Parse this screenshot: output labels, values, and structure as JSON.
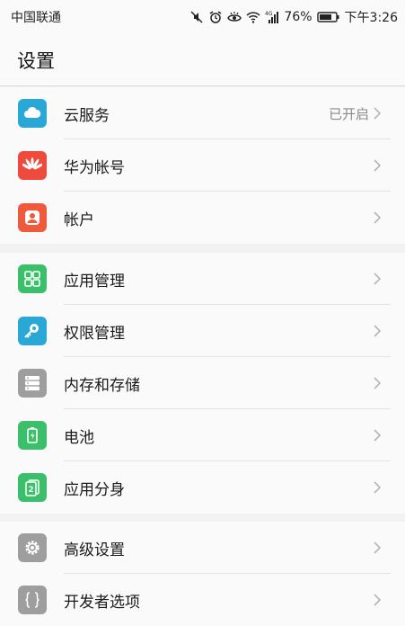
{
  "status_bar": {
    "carrier": "中国联通",
    "network_label": "4G",
    "battery_percent": "76%",
    "time": "下午3:26"
  },
  "header": {
    "title": "设置"
  },
  "groups": [
    {
      "items": [
        {
          "label": "云服务",
          "value": "已开启",
          "icon": "cloud-icon",
          "color": "#29a8d8"
        },
        {
          "label": "华为帐号",
          "value": "",
          "icon": "huawei-logo-icon",
          "color": "#ee4b3c"
        },
        {
          "label": "帐户",
          "value": "",
          "icon": "user-account-icon",
          "color": "#f05a3c"
        }
      ]
    },
    {
      "items": [
        {
          "label": "应用管理",
          "value": "",
          "icon": "app-grid-icon",
          "color": "#3bbf6a"
        },
        {
          "label": "权限管理",
          "value": "",
          "icon": "key-icon",
          "color": "#29a8d8"
        },
        {
          "label": "内存和存储",
          "value": "",
          "icon": "storage-icon",
          "color": "#9e9e9e"
        },
        {
          "label": "电池",
          "value": "",
          "icon": "battery-icon",
          "color": "#3bbf6a"
        },
        {
          "label": "应用分身",
          "value": "",
          "icon": "app-twin-icon",
          "color": "#3bbf6a"
        }
      ]
    },
    {
      "items": [
        {
          "label": "高级设置",
          "value": "",
          "icon": "gear-icon",
          "color": "#9e9e9e"
        },
        {
          "label": "开发者选项",
          "value": "",
          "icon": "braces-icon",
          "color": "#9e9e9e"
        }
      ]
    }
  ]
}
